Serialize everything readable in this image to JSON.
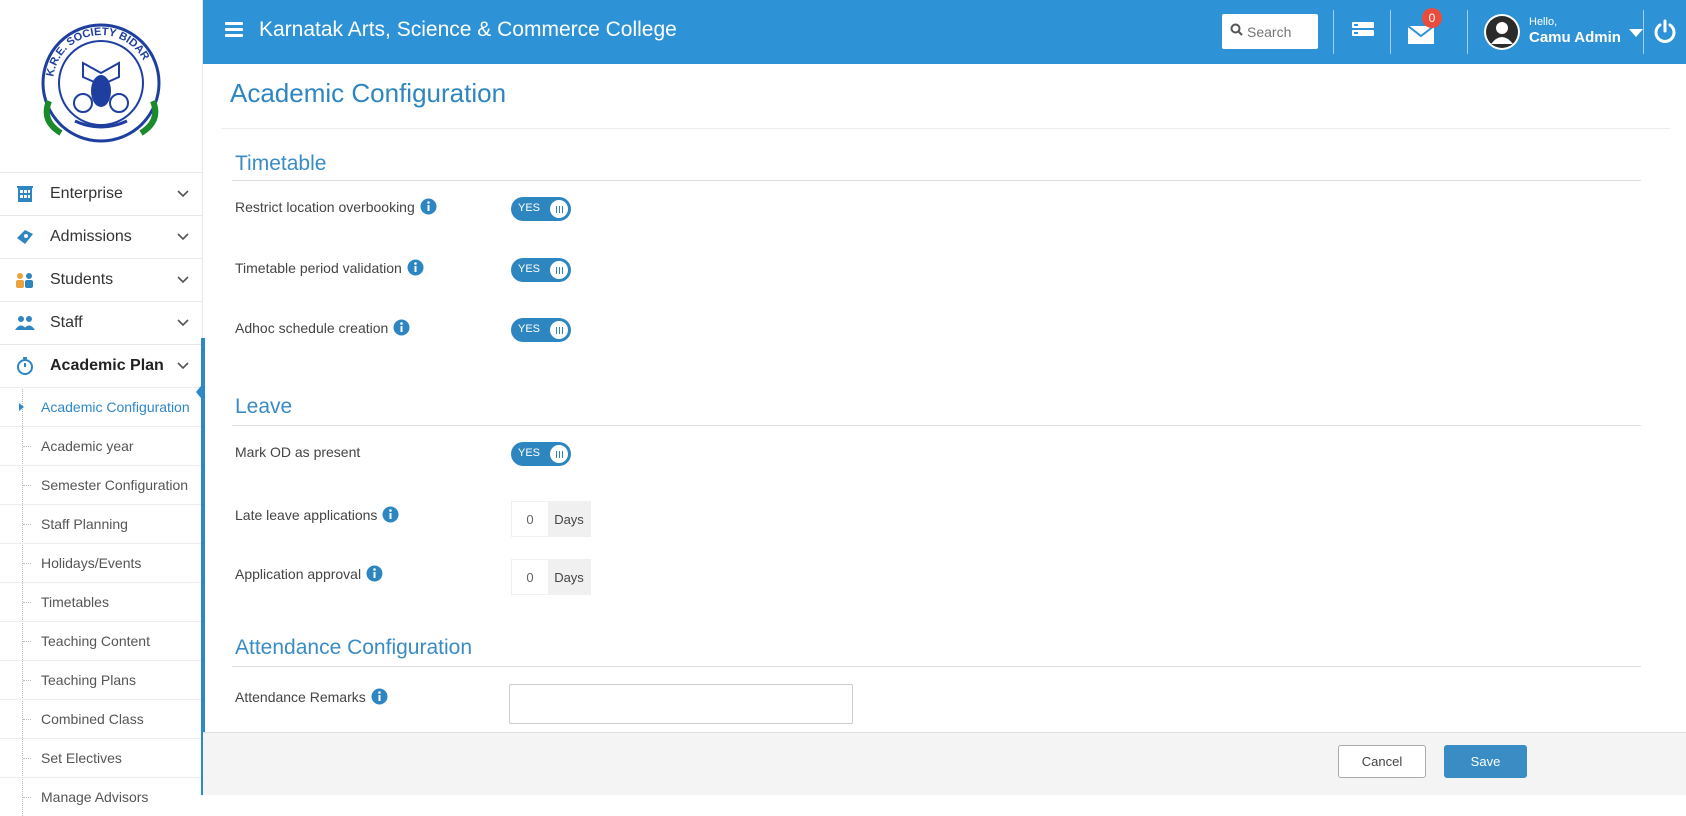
{
  "app": {
    "college_name": "Karnatak Arts, Science & Commerce College",
    "logo_text": "K.R.E. SOCIETY BIDAR"
  },
  "topbar": {
    "search_placeholder": "Search",
    "mail_count": "0",
    "greeting": "Hello,",
    "user_name": "Camu Admin"
  },
  "sidebar": {
    "items": [
      {
        "label": "Enterprise",
        "icon": "building-icon"
      },
      {
        "label": "Admissions",
        "icon": "ticket-icon"
      },
      {
        "label": "Students",
        "icon": "students-icon"
      },
      {
        "label": "Staff",
        "icon": "staff-icon"
      },
      {
        "label": "Academic Plan",
        "icon": "stopwatch-icon"
      }
    ],
    "submenu": [
      "Academic Configuration",
      "Academic year",
      "Semester Configuration",
      "Staff Planning",
      "Holidays/Events",
      "Timetables",
      "Teaching Content",
      "Teaching Plans",
      "Combined Class",
      "Set Electives",
      "Manage Advisors"
    ]
  },
  "main": {
    "page_title": "Academic Configuration",
    "timetable": {
      "title": "Timetable",
      "fields": [
        {
          "label": "Restrict location overbooking",
          "value": "YES"
        },
        {
          "label": "Timetable period validation",
          "value": "YES"
        },
        {
          "label": "Adhoc schedule creation",
          "value": "YES"
        }
      ]
    },
    "leave": {
      "title": "Leave",
      "mark_od_label": "Mark OD as present",
      "mark_od_value": "YES",
      "late_leave_label": "Late leave applications",
      "late_leave_value": "0",
      "approval_label": "Application approval",
      "approval_value": "0",
      "days_unit": "Days"
    },
    "attendance": {
      "title": "Attendance Configuration",
      "remarks_label": "Attendance Remarks"
    }
  },
  "footer": {
    "cancel_label": "Cancel",
    "save_label": "Save"
  },
  "colors": {
    "primary": "#2e93d6",
    "accent": "#2e86c1",
    "badge": "#e84c3d"
  }
}
